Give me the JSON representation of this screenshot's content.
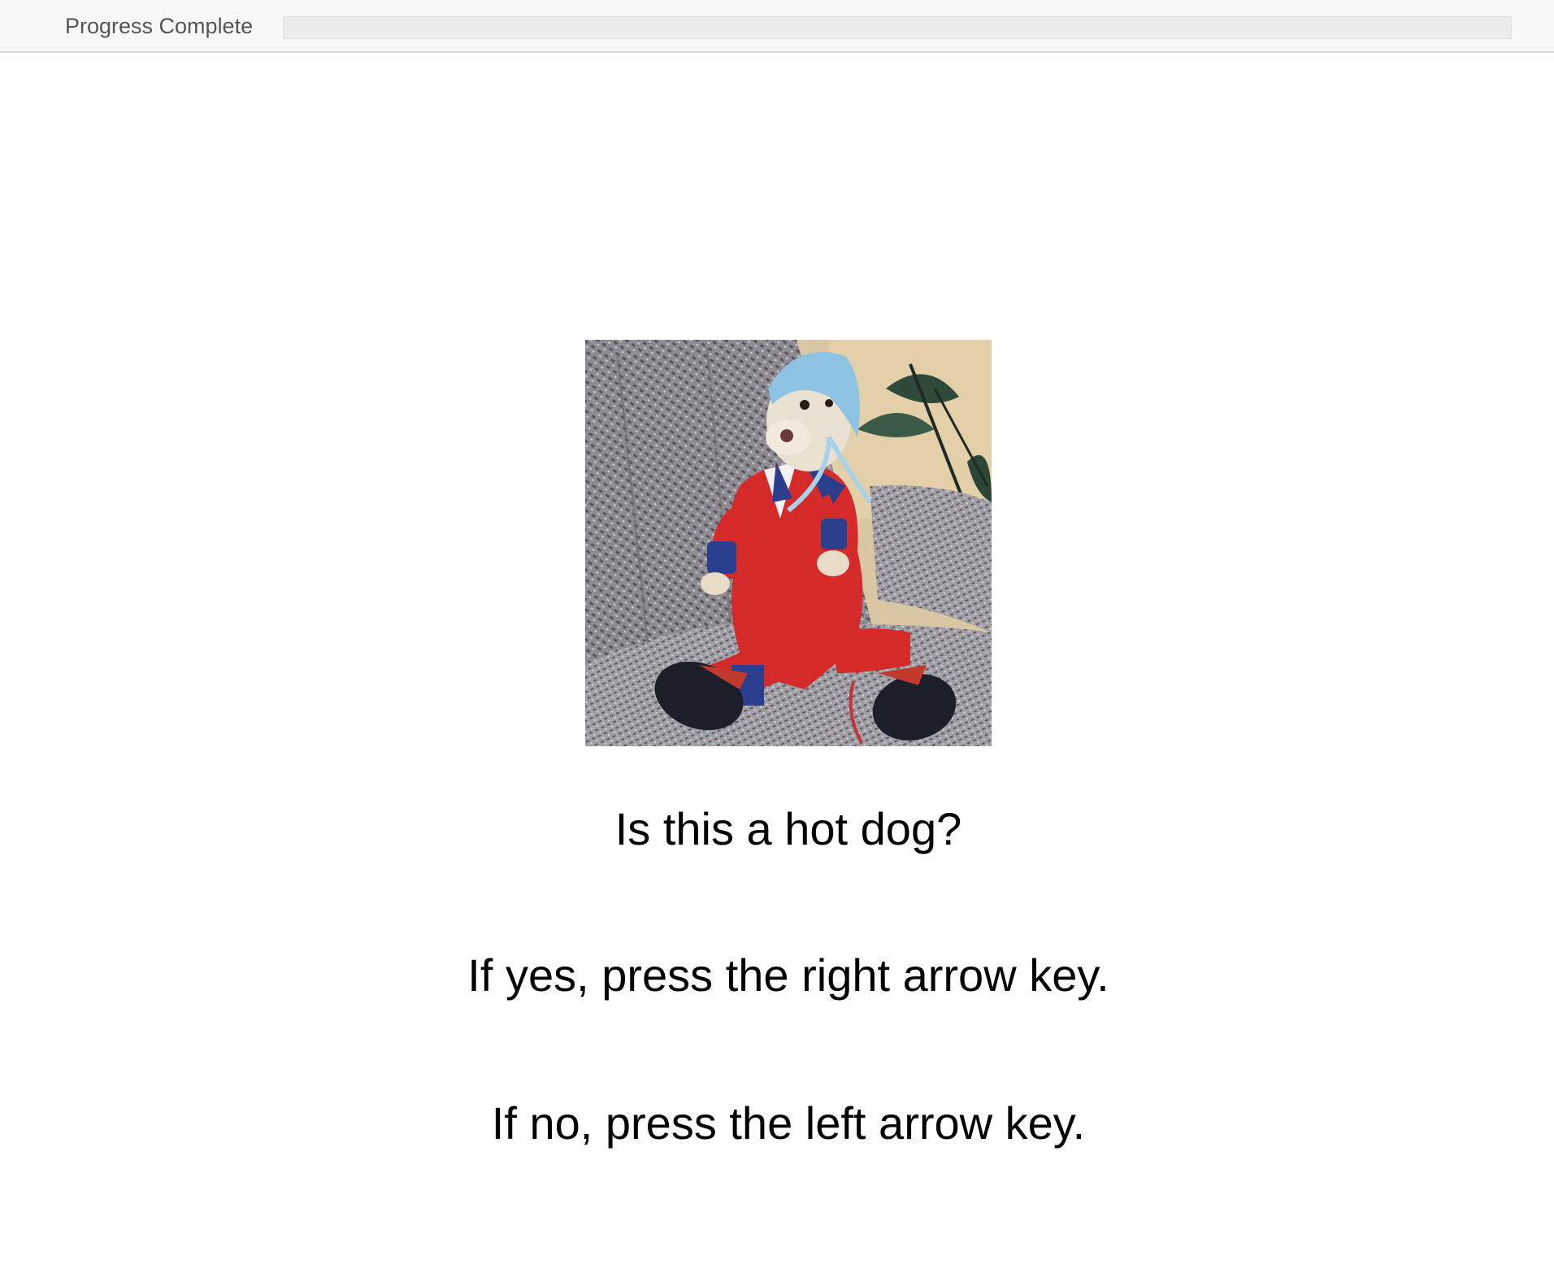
{
  "header": {
    "progress_label": "Progress Complete",
    "progress_fraction": 0.0
  },
  "stimulus": {
    "question": "Is this a hot dog?",
    "instruction_yes": "If yes, press the right arrow key.",
    "instruction_no": "If no, press the left arrow key."
  },
  "colors": {
    "progress_track": "#ececec",
    "progress_fill": "#4a90d9",
    "text": "#000000"
  }
}
